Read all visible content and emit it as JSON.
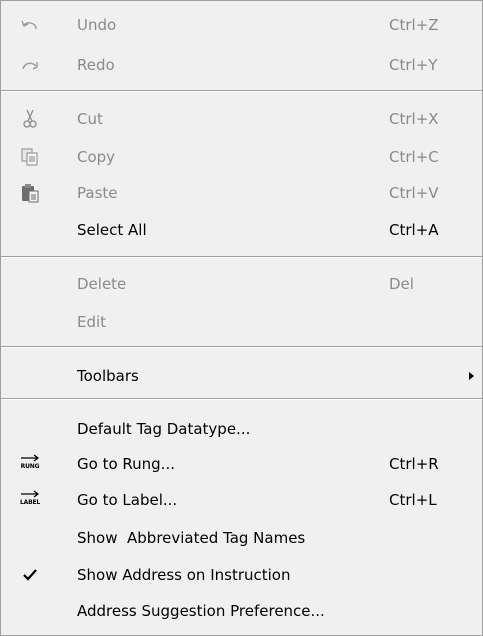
{
  "menu": {
    "items": [
      {
        "label": "Undo",
        "shortcut": "Ctrl+Z",
        "icon": "undo-icon",
        "enabled": false
      },
      {
        "label": "Redo",
        "shortcut": "Ctrl+Y",
        "icon": "redo-icon",
        "enabled": false
      },
      {
        "label": "Cut",
        "shortcut": "Ctrl+X",
        "icon": "scissors-icon",
        "enabled": false
      },
      {
        "label": "Copy",
        "shortcut": "Ctrl+C",
        "icon": "copy-icon",
        "enabled": false
      },
      {
        "label": "Paste",
        "shortcut": "Ctrl+V",
        "icon": "paste-icon",
        "enabled": false
      },
      {
        "label": "Select All",
        "shortcut": "Ctrl+A",
        "icon": "",
        "enabled": true
      },
      {
        "label": "Delete",
        "shortcut": "Del",
        "icon": "",
        "enabled": false
      },
      {
        "label": "Edit",
        "shortcut": "",
        "icon": "",
        "enabled": false
      },
      {
        "label": "Toolbars",
        "shortcut": "",
        "icon": "submenu-arrow-icon",
        "enabled": true
      },
      {
        "label": "Default Tag Datatype...",
        "shortcut": "",
        "icon": "",
        "enabled": true
      },
      {
        "label": "Go to Rung...",
        "shortcut": "Ctrl+R",
        "icon": "goto-rung-icon",
        "icon_text": "RUNG",
        "enabled": true
      },
      {
        "label": "Go to Label...",
        "shortcut": "Ctrl+L",
        "icon": "goto-label-icon",
        "icon_text": "LABEL",
        "enabled": true
      },
      {
        "label": "Show  Abbreviated Tag Names",
        "shortcut": "",
        "icon": "",
        "enabled": true
      },
      {
        "label": "Show Address on Instruction",
        "shortcut": "",
        "icon": "checkmark-icon",
        "checked": true,
        "enabled": true
      },
      {
        "label": "Address Suggestion Preference...",
        "shortcut": "",
        "icon": "",
        "enabled": true
      }
    ]
  },
  "colors": {
    "background": "#f0f0f0",
    "disabled_text": "#8a8a8a",
    "enabled_text": "#000000",
    "separator": "#a0a0a0"
  }
}
